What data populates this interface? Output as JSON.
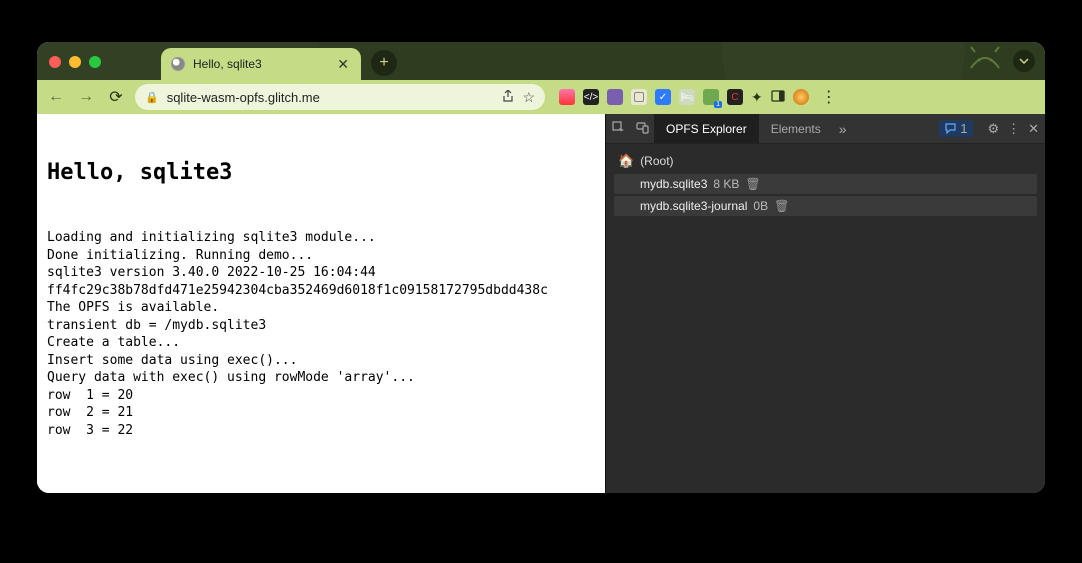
{
  "tab": {
    "title": "Hello, sqlite3"
  },
  "address": {
    "url": "sqlite-wasm-opfs.glitch.me"
  },
  "page": {
    "heading": "Hello, sqlite3",
    "lines": [
      "Loading and initializing sqlite3 module...",
      "Done initializing. Running demo...",
      "sqlite3 version 3.40.0 2022-10-25 16:04:44",
      "ff4fc29c38b78dfd471e25942304cba352469d6018f1c09158172795dbdd438c",
      "The OPFS is available.",
      "transient db = /mydb.sqlite3",
      "Create a table...",
      "Insert some data using exec()...",
      "Query data with exec() using rowMode 'array'...",
      "row  1 = 20",
      "row  2 = 21",
      "row  3 = 22"
    ]
  },
  "devtools": {
    "tabs": {
      "active": "OPFS Explorer",
      "second": "Elements"
    },
    "badge_count": "1",
    "tree": {
      "root_label": "(Root)",
      "items": [
        {
          "name": "mydb.sqlite3",
          "size": "8 KB"
        },
        {
          "name": "mydb.sqlite3-journal",
          "size": "0B"
        }
      ]
    }
  }
}
